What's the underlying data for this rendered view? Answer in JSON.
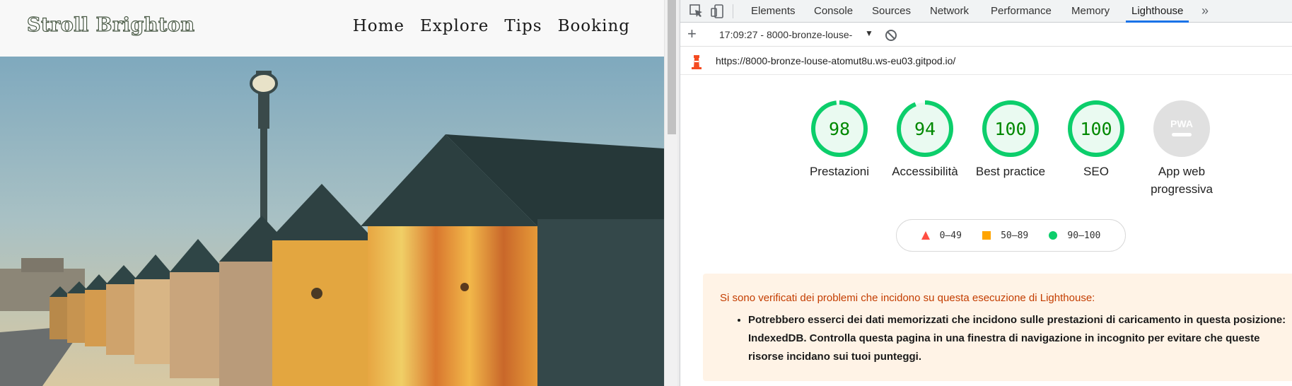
{
  "site": {
    "brand": "Stroll Brighton",
    "nav": [
      "Home",
      "Explore",
      "Tips",
      "Booking"
    ]
  },
  "devtools": {
    "tabs": [
      "Elements",
      "Console",
      "Sources",
      "Network",
      "Performance",
      "Memory",
      "Lighthouse"
    ],
    "active_tab": "Lighthouse",
    "report_select": "17:09:27 - 8000-bronze-louse-",
    "url": "https://8000-bronze-louse-atomut8u.ws-eu03.gitpod.io/",
    "scores": [
      {
        "label": "Prestazioni",
        "value": 98
      },
      {
        "label": "Accessibilità",
        "value": 94
      },
      {
        "label": "Best practice",
        "value": 100
      },
      {
        "label": "SEO",
        "value": 100
      }
    ],
    "pwa": {
      "label_line1": "App web",
      "label_line2": "progressiva",
      "badge": "PWA"
    },
    "legend": [
      "0–49",
      "50–89",
      "90–100"
    ],
    "colors": {
      "pass": "#0cce6b",
      "average": "#ffa400",
      "fail": "#ff4e42",
      "pass_text": "#008800",
      "active_tab": "#1a73e8",
      "warn_text": "#c33d00"
    },
    "warning": {
      "title": "Si sono verificati dei problemi che incidono su questa esecuzione di Lighthouse:",
      "items": [
        [
          "Potrebbero esserci dei dati memorizzati che incidono sulle prestazioni di caricamento in questa posizione:",
          "IndexedDB. Controlla questa pagina in una finestra di navigazione in incognito per evitare che queste",
          "risorse incidano sui tuoi punteggi."
        ]
      ]
    }
  }
}
